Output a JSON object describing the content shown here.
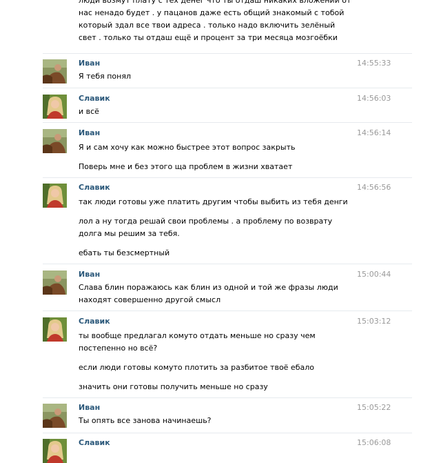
{
  "top_lines": [
    "люди возмут плату с тех денег что ты отдаш никаких вложений от",
    "нас ненадо будет . у пацанов даже есть общий знакомый с тобой",
    "который здал все твои адреса . только надо включить зелёный",
    "свет . только ты отдаш ещё и процент за три месяца мозгоёбки"
  ],
  "messages": [
    {
      "author": "Иван",
      "time": "14:55:33",
      "lines": [
        "Я тебя понял"
      ]
    },
    {
      "author": "Славик",
      "time": "14:56:03",
      "lines": [
        "и всё"
      ]
    },
    {
      "author": "Иван",
      "time": "14:56:14",
      "lines": [
        "Я и сам хочу как можно быстрее этот вопрос закрыть",
        "Поверь мне и без этого ща проблем в жизни хватает"
      ]
    },
    {
      "author": "Славик",
      "time": "14:56:56",
      "lines": [
        "так люди готовы уже платить другим чтобы выбить из тебя денги",
        "лол а ну тогда решай свои проблемы . а проблему по возврату",
        "долга мы решим за тебя.",
        "ебать ты безсмертный"
      ]
    },
    {
      "author": "Иван",
      "time": "15:00:44",
      "lines": [
        "Слава блин поражаюсь как блин из одной и той же фразы люди",
        "находят совершенно другой смысл"
      ]
    },
    {
      "author": "Славик",
      "time": "15:03:12",
      "lines": [
        "ты вообще предлагал комуто отдать меньше но сразу чем",
        "постепенно но всё?",
        "если люди готовы комуто плотить за разбитое твоё ебало",
        "значить они готовы получить меньше но сразу"
      ]
    },
    {
      "author": "Иван",
      "time": "15:05:22",
      "lines": [
        "Ты опять все занова начинаешь?"
      ]
    },
    {
      "author": "Славик",
      "time": "15:06:08",
      "lines": []
    }
  ]
}
